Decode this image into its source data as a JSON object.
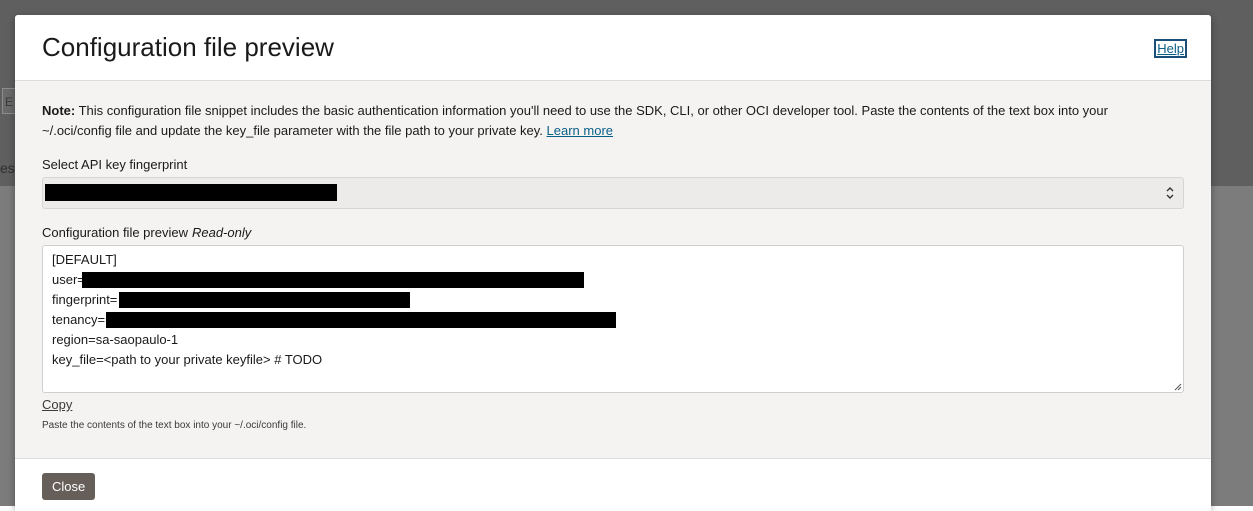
{
  "background": {
    "fragment_box_text": "E",
    "fragment_text": "es"
  },
  "dialog": {
    "title": "Configuration file preview",
    "help_label": "Help",
    "note_prefix": "Note:",
    "note_text": " This configuration file snippet includes the basic authentication information you'll need to use the SDK, CLI, or other OCI developer tool. Paste the contents of the text box into your ~/.oci/config file and update the key_file parameter with the file path to your private key. ",
    "learn_more_label": "Learn more",
    "fingerprint_label": "Select API key fingerprint",
    "preview_label": "Configuration file preview",
    "readonly_label": "Read-only",
    "config_lines": {
      "section": "[DEFAULT]",
      "user_key": "user=",
      "fingerprint_key": "fingerprint=",
      "tenancy_key": "tenancy=",
      "region": "region=sa-saopaulo-1",
      "key_file": "key_file=<path to your private keyfile> # TODO"
    },
    "copy_label": "Copy",
    "hint": "Paste the contents of the text box into your ~/.oci/config file.",
    "close_label": "Close"
  },
  "colors": {
    "link": "#0a5f86",
    "close_button": "#665e58",
    "dialog_body": "#f4f3f1",
    "backdrop": "#5f5f5f"
  }
}
